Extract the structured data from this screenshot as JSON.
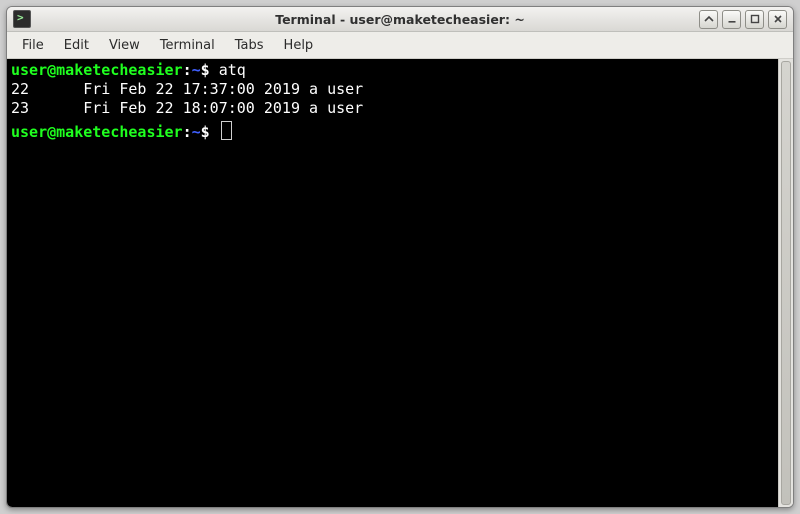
{
  "window": {
    "title": "Terminal - user@maketecheasier: ~"
  },
  "menus": {
    "file": "File",
    "edit": "Edit",
    "view": "View",
    "terminal": "Terminal",
    "tabs": "Tabs",
    "help": "Help"
  },
  "prompt": {
    "user": "user",
    "at": "@",
    "host": "maketecheasier",
    "colon": ":",
    "path": "~",
    "symbol": "$"
  },
  "session": {
    "command1": "atq",
    "output": [
      "22      Fri Feb 22 17:37:00 2019 a user",
      "23      Fri Feb 22 18:07:00 2019 a user"
    ],
    "command2": ""
  },
  "colors": {
    "prompt_user": "#1fff1f",
    "prompt_path": "#4060ff",
    "bg": "#000000",
    "fg": "#ffffff"
  }
}
